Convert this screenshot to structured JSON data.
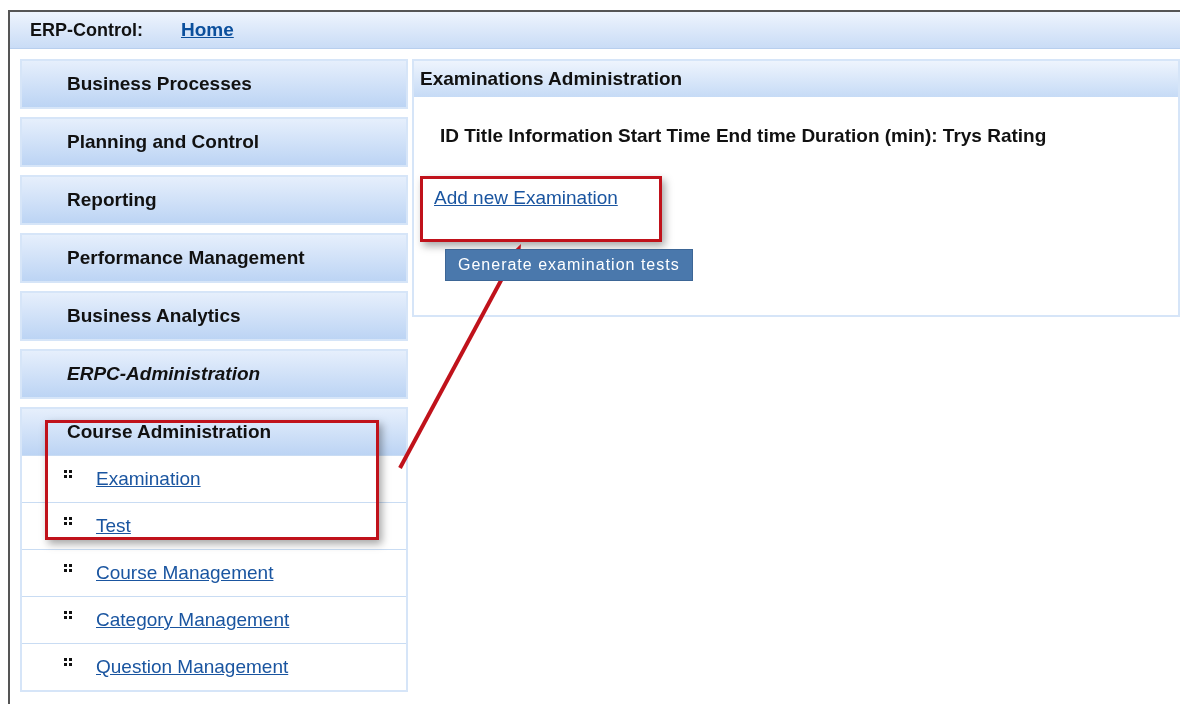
{
  "header": {
    "title": "ERP-Control:",
    "home_link": "Home"
  },
  "sidebar": {
    "sections": [
      {
        "label": "Business Processes",
        "emphasized": false
      },
      {
        "label": "Planning and Control",
        "emphasized": false
      },
      {
        "label": "Reporting",
        "emphasized": false
      },
      {
        "label": "Performance Management",
        "emphasized": false
      },
      {
        "label": "Business Analytics",
        "emphasized": false
      },
      {
        "label": "ERPC-Administration",
        "emphasized": true
      },
      {
        "label": "Course Administration",
        "emphasized": false,
        "children": [
          "Examination",
          "Test",
          "Course Management",
          "Category Management",
          "Question Management"
        ]
      }
    ]
  },
  "panel": {
    "title": "Examinations Administration",
    "columns": "ID Title Information Start Time End time Duration (min): Trys Rating",
    "add_link": "Add new Examination",
    "generate_button": "Generate examination tests"
  }
}
